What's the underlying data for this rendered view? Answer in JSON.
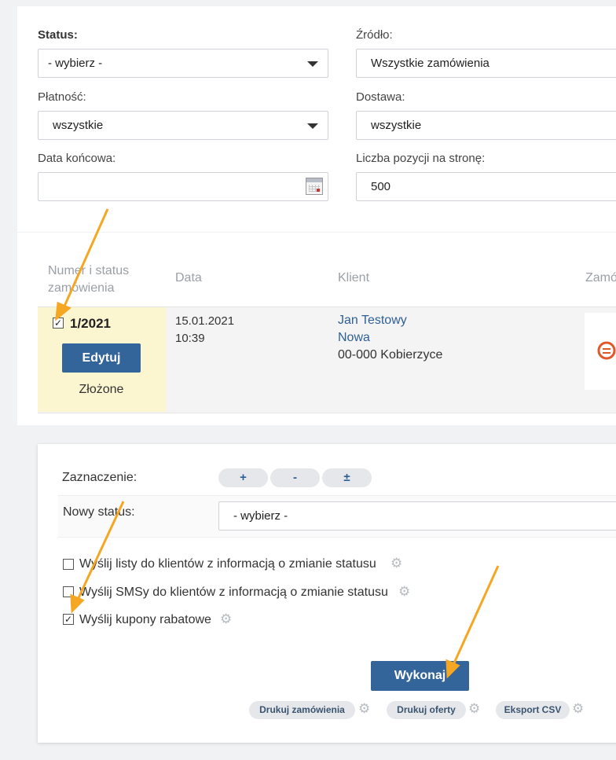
{
  "filters": {
    "status": {
      "label": "Status:",
      "value": "- wybierz -"
    },
    "source": {
      "label": "Źródło:",
      "value": "Wszystkie zamówienia"
    },
    "payment": {
      "label": "Płatność:",
      "value": "wszystkie"
    },
    "delivery": {
      "label": "Dostawa:",
      "value": "wszystkie"
    },
    "end_date": {
      "label": "Data końcowa:",
      "value": ""
    },
    "per_page": {
      "label": "Liczba pozycji na stronę:",
      "value": "500"
    }
  },
  "table": {
    "headers": {
      "number": "Numer i status zamówienia",
      "date": "Data",
      "client": "Klient",
      "order": "Zamó"
    },
    "row": {
      "number": "1/2021",
      "edit_label": "Edytuj",
      "status": "Złożone",
      "date": "15.01.2021",
      "time": "10:39",
      "client_name": "Jan Testowy",
      "client_company": "Nowa",
      "client_address": "00-000 Kobierzyce"
    }
  },
  "actions": {
    "selection_label": "Zaznaczenie:",
    "select_all": "+",
    "select_none": "-",
    "select_invert": "±",
    "new_status_label": "Nowy status:",
    "new_status_value": "- wybierz -",
    "options": [
      {
        "label": "Wyślij listy do klientów z informacją o zmianie statusu",
        "checked": false
      },
      {
        "label": "Wyślij SMSy do klientów z informacją o zmianie statusu",
        "checked": false
      },
      {
        "label": "Wyślij kupony rabatowe",
        "checked": true
      }
    ],
    "execute_label": "Wykonaj",
    "print_orders": "Drukuj zamówienia",
    "print_offers": "Drukuj oferty",
    "export_csv": "Eksport CSV"
  },
  "colors": {
    "accent": "#33649a",
    "highlight": "#fcf6d0",
    "arrow": "#f5a623"
  }
}
